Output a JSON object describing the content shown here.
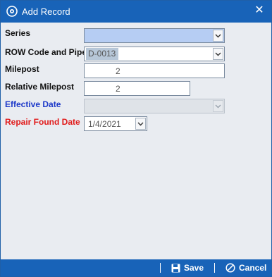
{
  "window": {
    "title": "Add Record",
    "app_icon": "app-gear-icon",
    "close_icon": "close-icon",
    "close_glyph": "✕"
  },
  "form": {
    "series": {
      "label": "Series",
      "value": "",
      "label_color": "#111111"
    },
    "row_code": {
      "label": "ROW Code and Pipe",
      "value": "D-0013"
    },
    "milepost": {
      "label": "Milepost",
      "value": "2"
    },
    "relative_milepost": {
      "label": "Relative Milepost",
      "value": "2"
    },
    "effective_date": {
      "label": "Effective Date",
      "value": "",
      "label_color": "#1d39c9",
      "disabled": true
    },
    "repair_found_date": {
      "label": "Repair Found Date",
      "value": "1/4/2021",
      "label_color": "#e11b1b"
    }
  },
  "footer": {
    "save_label": "Save",
    "save_icon": "save-icon",
    "cancel_label": "Cancel",
    "cancel_icon": "cancel-icon"
  },
  "colors": {
    "accent": "#1863b8",
    "background": "#e9ecf1",
    "series_fill": "#b6cdf3"
  }
}
